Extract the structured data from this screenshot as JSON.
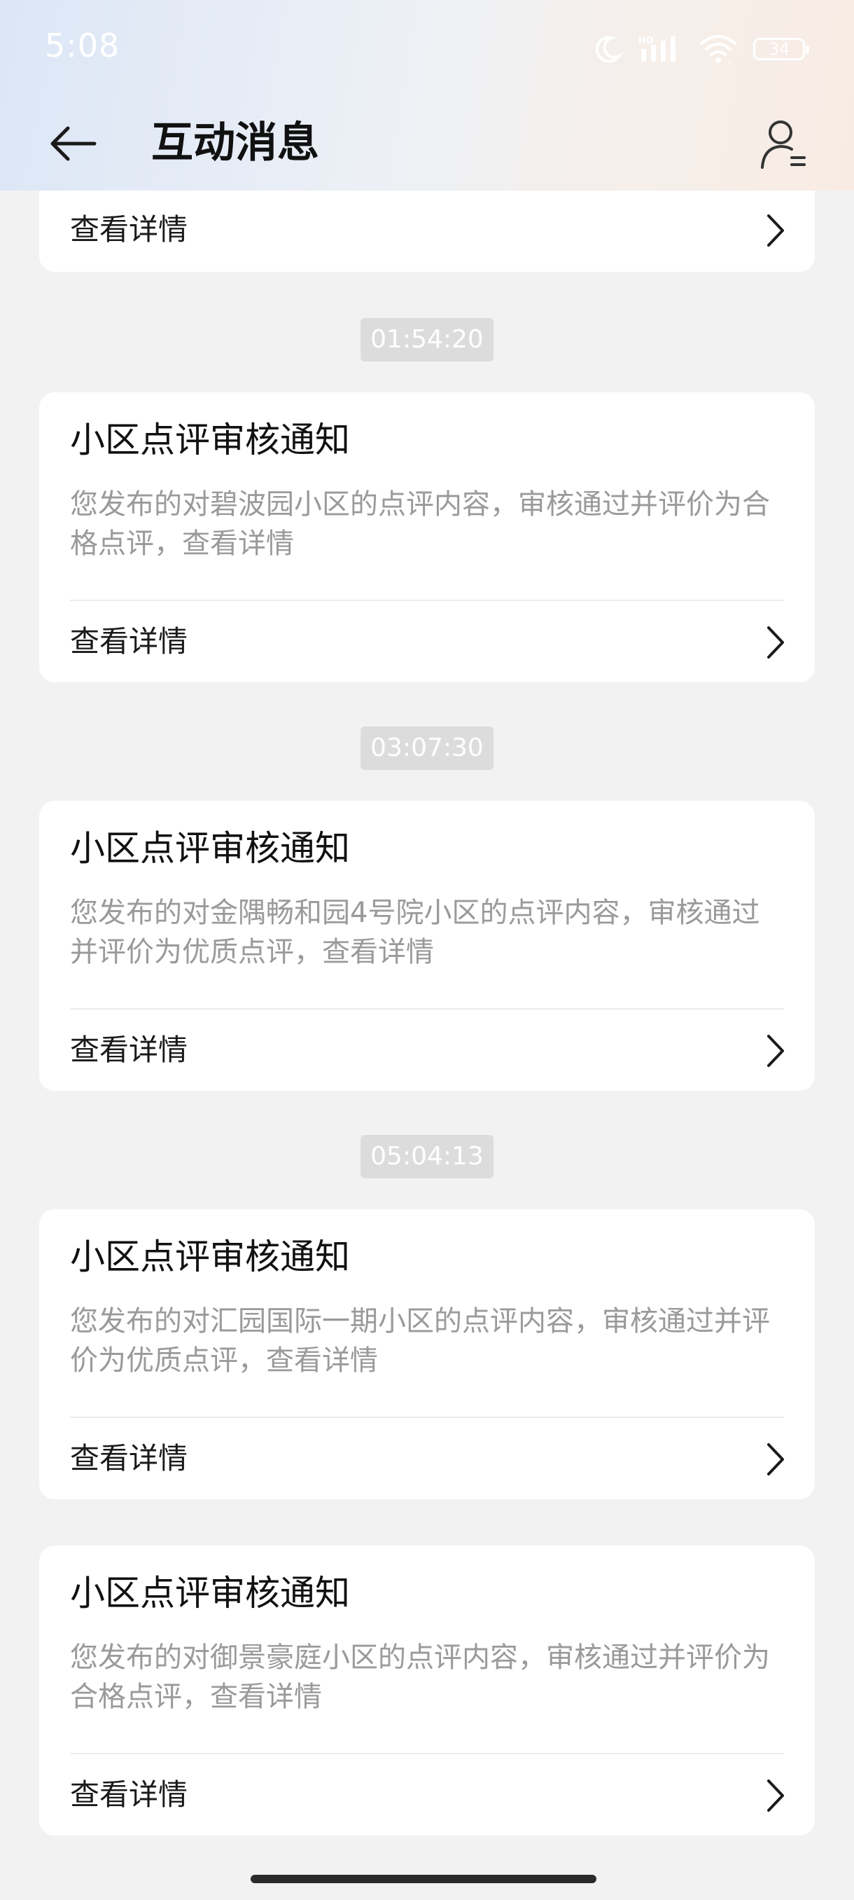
{
  "status_bar": {
    "time": "5:08",
    "battery": "34",
    "icons": [
      "moon-icon",
      "hd-signal-icon",
      "wifi-icon",
      "battery-icon"
    ]
  },
  "header": {
    "title": "互动消息",
    "back_icon": "arrow-left-icon",
    "profile_icon": "user-settings-icon"
  },
  "top_partial_card": {
    "link_label": "查看详情"
  },
  "timestamps": [
    "01:54:20",
    "03:07:30",
    "05:04:13"
  ],
  "cards": [
    {
      "title": "小区点评审核通知",
      "body": "您发布的对碧波园小区的点评内容，审核通过并评价为合格点评，查看详情",
      "link_label": "查看详情"
    },
    {
      "title": "小区点评审核通知",
      "body": "您发布的对金隅畅和园4号院小区的点评内容，审核通过并评价为优质点评，查看详情",
      "link_label": "查看详情"
    },
    {
      "title": "小区点评审核通知",
      "body": "您发布的对汇园国际一期小区的点评内容，审核通过并评价为优质点评，查看详情",
      "link_label": "查看详情"
    },
    {
      "title": "小区点评审核通知",
      "body": "您发布的对御景豪庭小区的点评内容，审核通过并评价为合格点评，查看详情",
      "link_label": "查看详情"
    }
  ],
  "colors": {
    "accent_text": "#111111",
    "secondary_text": "#9a9a9a",
    "badge_bg": "#dcdcdc",
    "page_bg": "#f2f2f2"
  }
}
